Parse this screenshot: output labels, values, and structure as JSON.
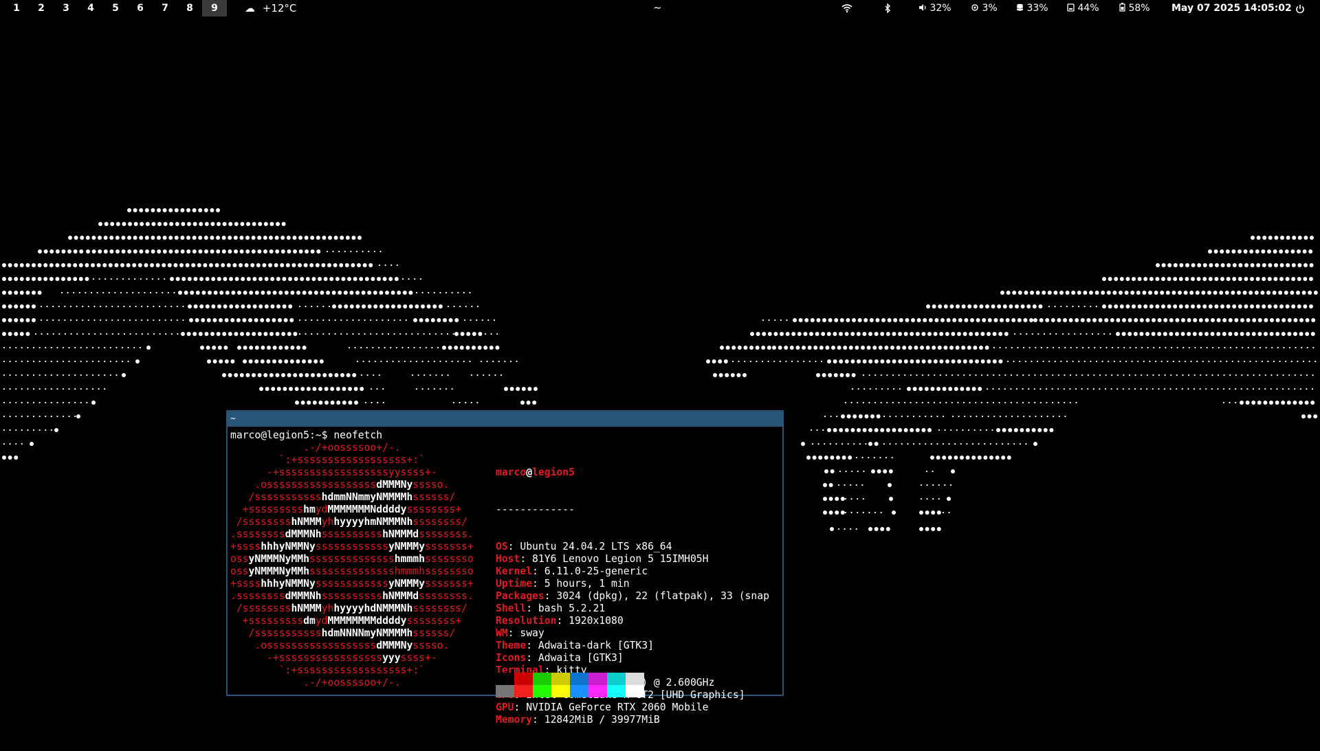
{
  "bar": {
    "workspaces": [
      "1",
      "2",
      "3",
      "4",
      "5",
      "6",
      "7",
      "8",
      "9"
    ],
    "active_workspace": "9",
    "weather": {
      "icon": "cloud-icon",
      "glyph": "☁",
      "text": "+12°C"
    },
    "window_title": "~",
    "wifi": {
      "icon": "wifi-icon"
    },
    "bluetooth": {
      "icon": "bluetooth-icon"
    },
    "volume": {
      "icon": "volume-icon",
      "text": "32%"
    },
    "cpu": {
      "icon": "cpu-icon",
      "text": "3%"
    },
    "memory": {
      "icon": "memory-icon",
      "text": "33%"
    },
    "disk": {
      "icon": "disk-icon",
      "text": "44%"
    },
    "battery": {
      "icon": "battery-icon",
      "text": "58%"
    },
    "clock": "May 07 2025 14:05:02",
    "power": {
      "icon": "power-icon"
    }
  },
  "terminal": {
    "title": "~",
    "prompt": "marco@legion5:~$ neofetch",
    "user": "marco",
    "at": "@",
    "host": "legion5",
    "separator": "-------------",
    "info": [
      {
        "key": "OS",
        "value": "Ubuntu 24.04.2 LTS x86_64"
      },
      {
        "key": "Host",
        "value": "81Y6 Lenovo Legion 5 15IMH05H"
      },
      {
        "key": "Kernel",
        "value": "6.11.0-25-generic"
      },
      {
        "key": "Uptime",
        "value": "5 hours, 1 min"
      },
      {
        "key": "Packages",
        "value": "3024 (dpkg), 22 (flatpak), 33 (snap"
      },
      {
        "key": "Shell",
        "value": "bash 5.2.21"
      },
      {
        "key": "Resolution",
        "value": "1920x1080"
      },
      {
        "key": "WM",
        "value": "sway"
      },
      {
        "key": "Theme",
        "value": "Adwaita-dark [GTK3]"
      },
      {
        "key": "Icons",
        "value": "Adwaita [GTK3]"
      },
      {
        "key": "Terminal",
        "value": "kitty"
      },
      {
        "key": "CPU",
        "value": "Intel i7-10750H (12) @ 2.600GHz"
      },
      {
        "key": "GPU",
        "value": "Intel CometLake-H GT2 [UHD Graphics]"
      },
      {
        "key": "GPU",
        "value": "NVIDIA GeForce RTX 2060 Mobile"
      },
      {
        "key": "Memory",
        "value": "12842MiB / 39977MiB"
      }
    ],
    "logo": [
      "            .-/+oossssoo+/-.",
      "        `:+ssssssssssssssssss+:`",
      "      -+ssssssssssssssssssyyssss+-",
      "    .ossssssssssssssssss|dMMMNy|sssso.",
      "   /sssssssssss|hdmmNNmmyNMMMMh|ssssss/",
      "  +sssssssss|hm|yd|MMMMMMMNddddy|ssssssss+",
      " /ssssssss|hNMMM|yh|hyyyyhmNMMMNh|ssssssss/",
      ".ssssssss|dMMMNh|ssssssssss|hNMMMd|ssssssss.",
      "+ssss|hhhyNMMNy|ssssssssssss|yNMMMy|sssssss+",
      "oss|yNMMMNyMMh|ssssssssssssss|hmmmh|ssssssso",
      "oss|yNMMMNyMMh|sssssssssssssshmmmhssssssso",
      "+ssss|hhhyNMMNy|ssssssssssss|yNMMMy|sssssss+",
      ".ssssssss|dMMMNh|ssssssssss|hNMMMd|ssssssss.",
      " /ssssssss|hNMMM|yh|hyyyyhdNMMMNh|ssssssss/",
      "  +sssssssss|dm|yd|MMMMMMMMddddy|ssssssss+",
      "   /sssssssssss|hdmNNNNmyNMMMMh|ssssss/",
      "    .ossssssssssssssssss|dMMMNy|sssso.",
      "      -+sssssssssssssssss|yyy|ssss+-",
      "        `:+ssssssssssssssssss+:`",
      "            .-/+oossssoo+/-."
    ],
    "colors": {
      "row1": [
        "#000000",
        "#cc0000",
        "#4e9a06",
        "#c4a000",
        "#3465a4",
        "#75507b",
        "#06989a",
        "#d3d7cf"
      ],
      "row2": [
        "#555753",
        "#ef2929",
        "#8ae234",
        "#fce94f",
        "#729fcf",
        "#ad7fa8",
        "#34e2e2",
        "#eeeeec"
      ],
      "row1_actual": [
        "#000000",
        "#c01c28",
        "#26a269",
        "#a2734c",
        "#12488b",
        "#a347ba",
        "#2aa1b3",
        "#d0cfcc"
      ]
    }
  }
}
